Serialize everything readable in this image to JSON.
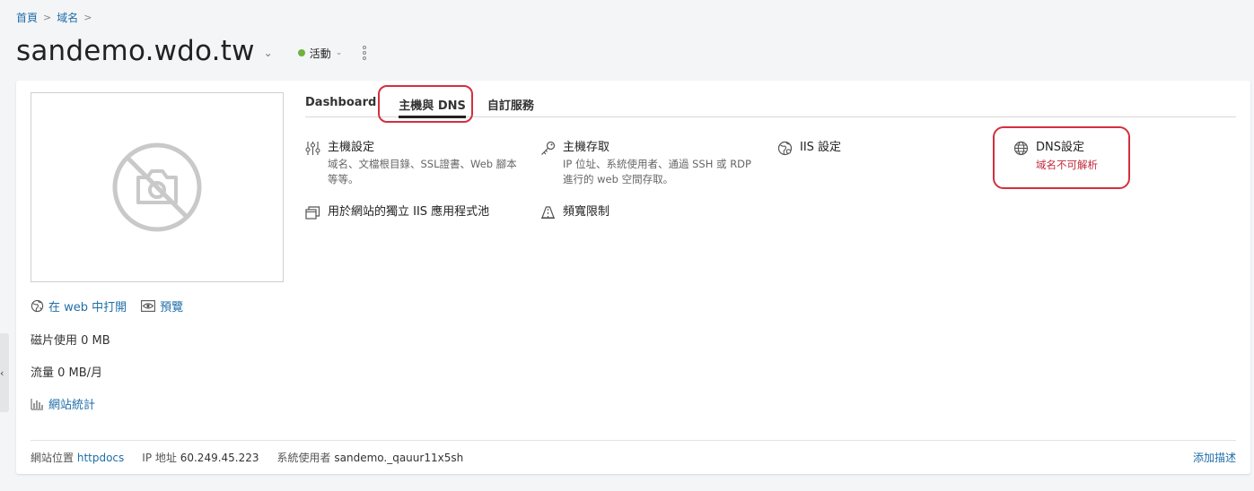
{
  "breadcrumb": {
    "home": "首頁",
    "domains": "域名",
    "sep": ">"
  },
  "header": {
    "title": "sandemo.wdo.tw",
    "status_label": "活動",
    "status_color": "#6db33f"
  },
  "tabs": [
    {
      "label": "Dashboard"
    },
    {
      "label": "主機與 DNS"
    },
    {
      "label": "自訂服務"
    }
  ],
  "tools": {
    "hosting_settings": {
      "title": "主機設定",
      "desc_line1": "域名、文檔根目錄、SSL證書、Web 腳本",
      "desc_line2": "等等。"
    },
    "hosting_access": {
      "title": "主機存取",
      "desc_line1": "IP 位址、系統使用者、通過 SSH 或 RDP",
      "desc_line2": "進行的 web 空間存取。"
    },
    "iis_settings": {
      "title": "IIS 設定"
    },
    "dns_settings": {
      "title": "DNS設定",
      "warning": "域名不可解析"
    },
    "app_pool": {
      "title": "用於網站的獨立 IIS 應用程式池"
    },
    "bandwidth": {
      "title": "頻寬限制"
    }
  },
  "left": {
    "open_in_web": "在 web 中打開",
    "preview": "預覽",
    "disk_usage": "磁片使用 0 MB",
    "traffic": "流量 0 MB/月",
    "site_stats": "網站統計"
  },
  "footer": {
    "site_location_label": "網站位置",
    "site_location_value": "httpdocs",
    "ip_label": "IP 地址",
    "ip_value": "60.249.45.223",
    "sysuser_label": "系統使用者",
    "sysuser_value": "sandemo._qauur11x5sh",
    "add_description": "添加描述"
  },
  "colors": {
    "link": "#1f6ea8",
    "warning": "#c0283a",
    "highlight": "#d32f3f"
  }
}
